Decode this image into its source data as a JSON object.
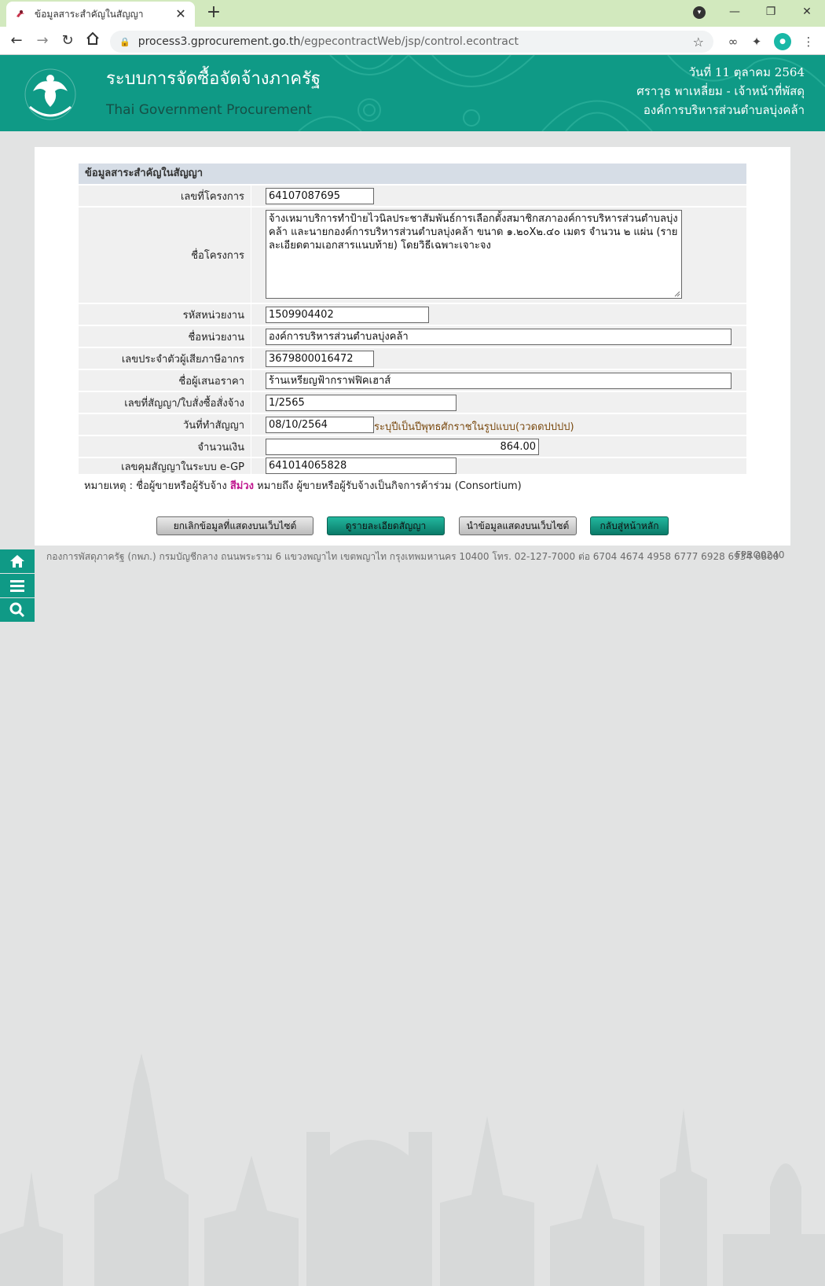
{
  "browser": {
    "tab_title": "ข้อมูลสาระสำคัญในสัญญา",
    "new_tab_symbol": "+",
    "url_host": "process3.gprocurement.go.th",
    "url_path": "/egpecontractWeb/jsp/control.econtract",
    "icons": [
      "back-icon",
      "forward-icon",
      "reload-icon",
      "home-icon",
      "lock-icon",
      "star-icon",
      "extension-icon",
      "puzzle-icon",
      "profile-avatar",
      "menu-icon"
    ]
  },
  "header": {
    "title_th": "ระบบการจัดซื้อจัดจ้างภาครัฐ",
    "title_en": "Thai Government Procurement",
    "date": "วันที่ 11 ตุลาคม 2564",
    "user": "ศราวุธ พาเหลี่ยม - เจ้าหน้าที่พัสดุ",
    "org": "องค์การบริหารส่วนตำบลบุ่งคล้า",
    "brand_color": "#0f9a86"
  },
  "form": {
    "section_title": "ข้อมูลสาระสำคัญในสัญญา",
    "fields": {
      "project_no": {
        "label": "เลขที่โครงการ",
        "value": "64107087695"
      },
      "project_name": {
        "label": "ชื่อโครงการ",
        "value": "จ้างเหมาบริการทำป้ายไวนิลประชาสัมพันธ์การเลือกตั้งสมาชิกสภาองค์การบริหารส่วนตำบลบุ่งคล้า และนายกองค์การบริหารส่วนตำบลบุ่งคล้า ขนาด ๑.๒๐X๒.๔๐ เมตร จำนวน ๒ แผ่น (รายละเอียดตามเอกสารแนบท้าย) โดยวิธีเฉพาะเจาะจง"
      },
      "agency_code": {
        "label": "รหัสหน่วยงาน",
        "value": "1509904402"
      },
      "agency_name": {
        "label": "ชื่อหน่วยงาน",
        "value": "องค์การบริหารส่วนตำบลบุ่งคล้า"
      },
      "tax_id": {
        "label": "เลขประจำตัวผู้เสียภาษีอากร",
        "value": "3679800016472"
      },
      "bidder_name": {
        "label": "ชื่อผู้เสนอราคา",
        "value": "ร้านเหรียญฟ้ากราฟฟิคเฮาส์"
      },
      "contract_no": {
        "label": "เลขที่สัญญา/ใบสั่งซื้อสั่งจ้าง",
        "value": "1/2565"
      },
      "contract_date": {
        "label": "วันที่ทำสัญญา",
        "value": "08/10/2564",
        "hint": "ระบุปีเป็นปีพุทธศักราชในรูปแบบ(ววดดปปปป)"
      },
      "amount": {
        "label": "จำนวนเงิน",
        "value": "864.00"
      },
      "egp_control_no": {
        "label": "เลขคุมสัญญาในระบบ e-GP",
        "value": "641014065828"
      }
    },
    "note_prefix": "หมายเหตุ : ชื่อผู้ขายหรือผู้รับจ้าง",
    "note_highlight": "สีม่วง",
    "note_suffix": "หมายถึง ผู้ขายหรือผู้รับจ้างเป็นกิจการค้าร่วม (Consortium)",
    "note_highlight_color": "#c0168e"
  },
  "buttons": {
    "cancel_publish": "ยกเลิกข้อมูลที่แสดงบนเว็บไซต์",
    "view_contract": "ดูรายละเอียดสัญญา",
    "publish": "นำข้อมูลแสดงบนเว็บไซต์",
    "back_home": "กลับสู่หน้าหลัก"
  },
  "footer": {
    "text": "กองการพัสดุภาครัฐ (กพภ.) กรมบัญชีกลาง ถนนพระราม 6 แขวงพญาไท เขตพญาไท กรุงเทพมหานคร 10400 โทร. 02-127-7000 ต่อ 6704 4674 4958 6777 6928 6934 6800",
    "page_code": "FPRO0240"
  },
  "side_tools": [
    "home-icon",
    "menu-icon",
    "search-icon"
  ]
}
